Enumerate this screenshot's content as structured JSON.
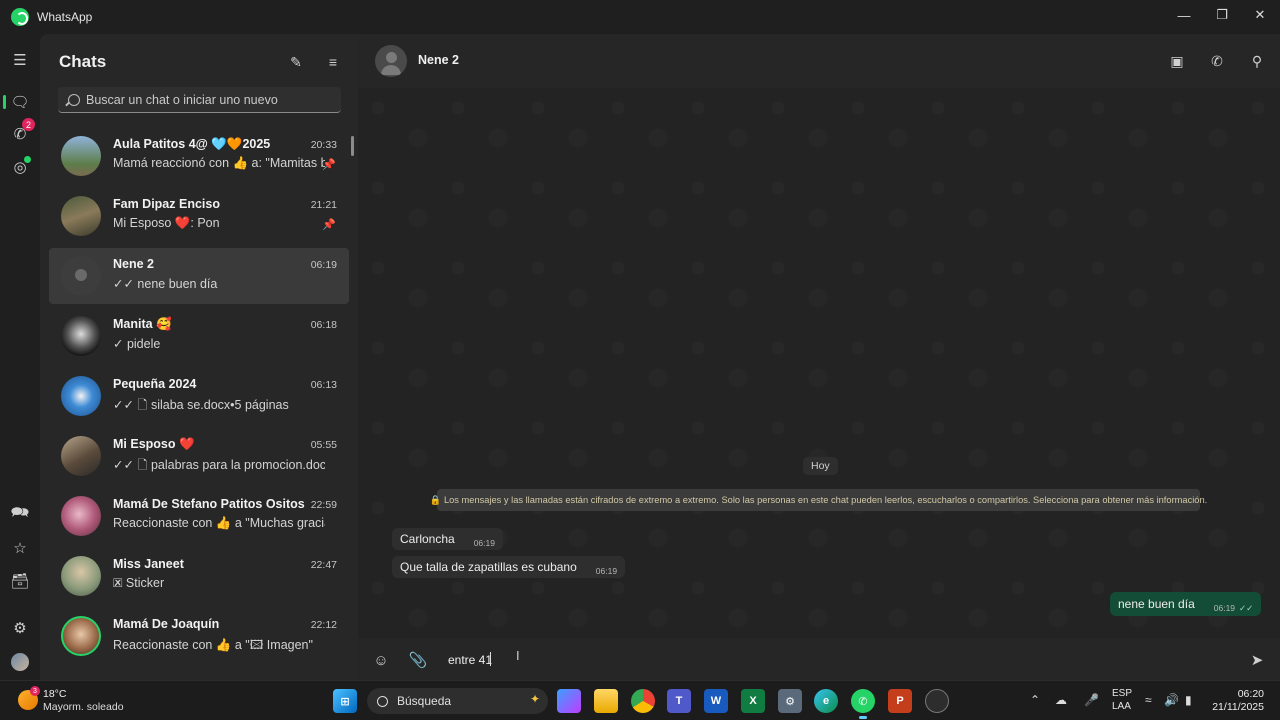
{
  "window": {
    "app_name": "WhatsApp"
  },
  "rail": {
    "calls_badge": "2"
  },
  "chats_panel": {
    "title": "Chats",
    "search_placeholder": "Buscar un chat o iniciar uno nuevo",
    "chats": [
      {
        "name": "Aula Patitos 4@ 🩵🧡2025",
        "time": "20:33",
        "preview": "Mamá reaccionó con 👍 a: \"Mamitas b...",
        "pinned": true
      },
      {
        "name": "Fam Dipaz Enciso",
        "time": "21:21",
        "preview": "Mi Esposo ❤️: Pon",
        "pinned": true
      },
      {
        "name": "Nene 2",
        "time": "06:19",
        "preview": "✓✓ nene buen día",
        "pinned": false
      },
      {
        "name": "Manita 🥰",
        "time": "06:18",
        "preview": "✓ pidele",
        "pinned": false
      },
      {
        "name": "Pequeña 2024",
        "time": "06:13",
        "preview": "✓✓ 🗋 silaba se.docx•5 páginas",
        "pinned": false
      },
      {
        "name": "Mi Esposo ❤️",
        "time": "05:55",
        "preview": "✓✓ 🗋 palabras para la promocion.docx",
        "pinned": false
      },
      {
        "name": "Mamá De Stefano Patitos Ositos",
        "time": "22:59",
        "preview": "Reaccionaste con 👍 a \"Muchas gracias...",
        "pinned": false
      },
      {
        "name": "Miss Janeet",
        "time": "22:47",
        "preview": "🗷 Sticker",
        "pinned": false
      },
      {
        "name": "Mamá De Joaquín",
        "time": "22:12",
        "preview": "Reaccionaste con 👍 a \"🖾 Imagen\"",
        "pinned": false
      }
    ]
  },
  "conversation": {
    "contact_name": "Nene 2",
    "day_label": "Hoy",
    "encryption_notice": "🔒 Los mensajes y las llamadas están cifrados de extremo a extremo. Solo las personas en este chat pueden leerlos, escucharlos o compartirlos. Selecciona para obtener más información.",
    "messages": [
      {
        "text": "Carloncha",
        "time": "06:19",
        "direction": "in"
      },
      {
        "text": "Que talla de zapatillas es cubano",
        "time": "06:19",
        "direction": "in"
      },
      {
        "text": "nene buen día",
        "time": "06:19",
        "direction": "out",
        "status": "✓✓"
      }
    ],
    "composer_text": "entre 41"
  },
  "taskbar": {
    "weather_temp": "18°C",
    "weather_desc": "Mayorm. soleado",
    "weather_badge": "3",
    "search_label": "Búsqueda",
    "lang_line1": "ESP",
    "lang_line2": "LAA",
    "time": "06:20",
    "date": "21/11/2025"
  },
  "colors": {
    "accent": "#25d366",
    "outgoing_bubble": "#134d37",
    "incoming_bubble": "#2e2e2e",
    "badge": "#e0245e"
  }
}
